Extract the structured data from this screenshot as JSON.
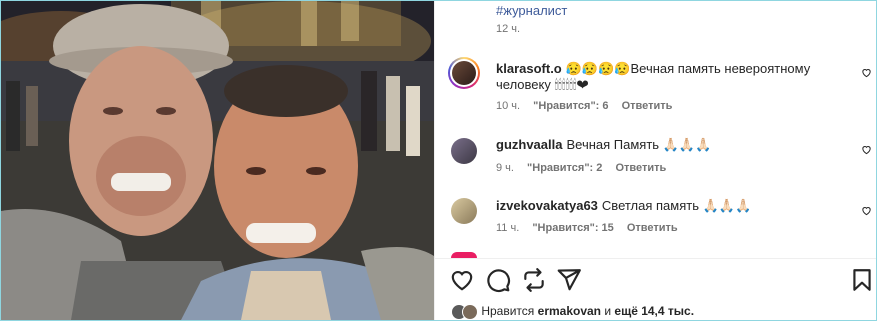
{
  "post": {
    "hashtag": "#журналист",
    "hashtag_time": "12 ч."
  },
  "comments": [
    {
      "username": "klarasoft.o",
      "text": "😥😥😥😥Вечная память невероятному человеку 🕯🕯🕯🕯🕯🕯❤",
      "time": "10 ч.",
      "likes": "\"Нравится\": 6",
      "reply": "Ответить",
      "avatar": "story-ring-avatar"
    },
    {
      "username": "guzhvaalla",
      "text": "Вечная Память 🙏🏻🙏🏻🙏🏻",
      "time": "9 ч.",
      "likes": "\"Нравится\": 2",
      "reply": "Ответить",
      "avatar": "avatar"
    },
    {
      "username": "izvekovakatya63",
      "text": "Светлая память 🙏🏻🙏🏻🙏🏻",
      "time": "11 ч.",
      "likes": "\"Нравится\": 15",
      "reply": "Ответить",
      "avatar": "avatar"
    }
  ],
  "actions": {
    "icons": [
      "heart-icon",
      "comment-icon",
      "repost-icon",
      "share-icon",
      "bookmark-icon"
    ]
  },
  "likes_line": {
    "prefix": "Нравится",
    "user": "ermakovan",
    "middle": "и",
    "count": "ещё 14,4 тыс."
  },
  "colors": {
    "hashtag": "#3d5a99",
    "text": "#262626",
    "meta": "#737373",
    "frame_border": "#8fd6e0"
  }
}
